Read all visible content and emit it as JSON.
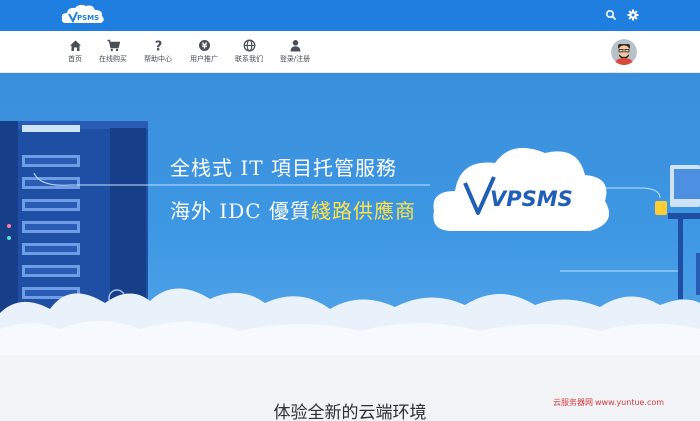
{
  "header": {
    "logo_alt": "VPSMS",
    "icons": [
      "search-icon",
      "gear-icon"
    ]
  },
  "nav": {
    "items": [
      {
        "label": "首页",
        "icon": "home-icon"
      },
      {
        "label": "在线购买",
        "icon": "cart-icon"
      },
      {
        "label": "帮助中心",
        "icon": "question-icon"
      },
      {
        "label": "用户推广",
        "icon": "coin-icon"
      },
      {
        "label": "联系我们",
        "icon": "globe-icon"
      },
      {
        "label": "登录/注册",
        "icon": "user-icon"
      }
    ]
  },
  "banner": {
    "line1": "全栈式 IT 項目托管服務",
    "line2_prefix": "海外 IDC 優質",
    "line2_highlight": "綫路供應商",
    "cloud_logo_text": "VPSMS"
  },
  "section": {
    "title": "体验全新的云端环境"
  },
  "watermark": {
    "cn": "云服务器网",
    "url": "www.yuntue.com"
  },
  "colors": {
    "topbar": "#1e7fe0",
    "banner": "#3d97e3",
    "highlight": "#ffe34a"
  }
}
